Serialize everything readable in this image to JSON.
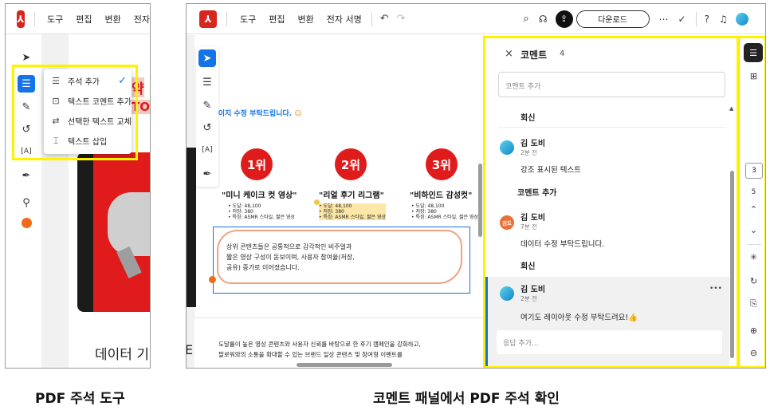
{
  "left": {
    "menu": [
      "도구",
      "편집",
      "변환",
      "전자"
    ],
    "annotation_menu": [
      {
        "label": "주석 추가",
        "icon": "comment-icon",
        "checked": true
      },
      {
        "label": "텍스트 코멘트 추가",
        "icon": "text-comment-icon",
        "checked": false
      },
      {
        "label": "선택한 텍스트 교체",
        "icon": "replace-text-icon",
        "checked": false
      },
      {
        "label": "텍스트 삽입",
        "icon": "insert-text-icon",
        "checked": false
      }
    ],
    "doc_heading_partial": "데이터 기",
    "doc_partial_chars": [
      "약",
      "TO"
    ],
    "caption": "PDF 주석 도구"
  },
  "right": {
    "menu": [
      "도구",
      "편집",
      "변환",
      "전자 서명"
    ],
    "download_label": "다운로드",
    "doc_request": "이 페이지 수정 부탁드립니다.",
    "ranks": [
      {
        "rank": "1위",
        "title": "\"미니 케이크 컷 영상\"",
        "stats": [
          "• 도달: 48,100",
          "• 저장: 380",
          "• 특징: ASMR 스타일, 짧은 영상"
        ]
      },
      {
        "rank": "2위",
        "title": "\"리얼 후기 리그램\"",
        "stats": [
          "• 도달: 48,100",
          "• 저장: 380",
          "• 특징: ASMR 스타일, 짧은 영상"
        ]
      },
      {
        "rank": "3위",
        "title": "\"비하인드 감성컷\"",
        "stats": [
          "• 도달: 48,100",
          "• 저장: 380",
          "• 특징: ASMR 스타일, 짧은 영상"
        ]
      }
    ],
    "doc_paragraph": [
      "상위 콘텐츠들은 공통적으로 감각적인 비주얼과",
      "짧은 영상 구성이 돋보이며, 사용자 참여율(저장,",
      "공유) 증가로 이어졌습니다."
    ],
    "doc_bottom": [
      "도달률이 높은 영상 콘텐츠와 사용자 신뢰를 바탕으로 한 후기 캠페인을 강화하고,",
      "팔로워와의 소통을 확대할 수 있는 브랜드 일상 콘텐츠 및 참여형 이벤트를"
    ],
    "left_edge_char": "E",
    "comments_panel": {
      "title": "코멘트",
      "count": "4",
      "add_placeholder": "코멘트 추가",
      "reply1": "회신",
      "entries": [
        {
          "name": "김 도비",
          "time": "2분 전",
          "text": "강조 표시된 텍스트",
          "avatar": "blue"
        },
        {
          "name": "김 도비",
          "time": "7분 전",
          "text": "데이터 수정 부탁드립니다.",
          "avatar": "orange",
          "avatar_label": "김도"
        }
      ],
      "add_comment": "코멘트 추가",
      "reply2": "회신",
      "selected": {
        "name": "김 도비",
        "time": "2분 전",
        "text": "여기도 레이아웃 수정 부탁드려요!👍",
        "more": "•••"
      },
      "reply_placeholder": "응답 추가..."
    },
    "rail": {
      "page_current": "3",
      "page_total": "5"
    },
    "caption": "코멘트 패널에서 PDF 주석 확인"
  },
  "colors": {
    "accent": "#1473e6",
    "highlight": "#fff200",
    "brand_red": "#d7261e",
    "rank_red": "#e01b1b"
  }
}
